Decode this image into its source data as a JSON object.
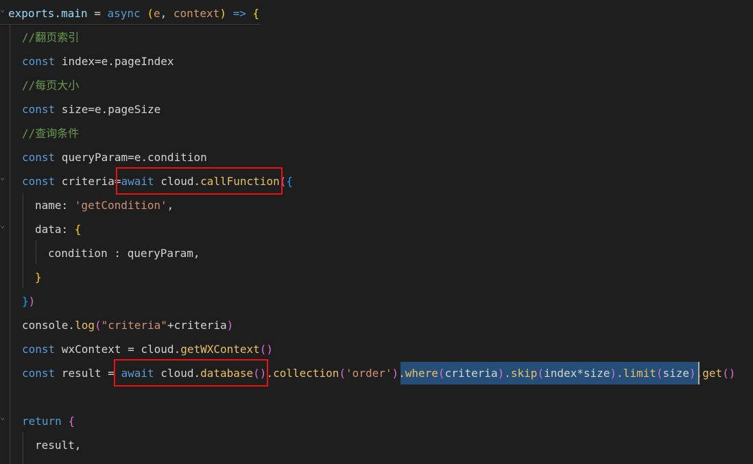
{
  "editor": {
    "lines": [
      {
        "id": "l1",
        "tokens": [
          {
            "t": "exports",
            "c": "tok-prop"
          },
          {
            "t": ".",
            "c": "tok-id"
          },
          {
            "t": "main",
            "c": "tok-prop"
          },
          {
            "t": " = ",
            "c": "tok-id"
          },
          {
            "t": "async",
            "c": "tok-kw"
          },
          {
            "t": " ",
            "c": "tok-id"
          },
          {
            "t": "(",
            "c": "tok-br"
          },
          {
            "t": "e",
            "c": "tok-param"
          },
          {
            "t": ", ",
            "c": "tok-id"
          },
          {
            "t": "context",
            "c": "tok-param"
          },
          {
            "t": ")",
            "c": "tok-br"
          },
          {
            "t": " => ",
            "c": "tok-kw"
          },
          {
            "t": "{",
            "c": "tok-br"
          }
        ]
      },
      {
        "id": "l2",
        "tokens": [
          {
            "t": "//翻页索引",
            "c": "tok-cm"
          }
        ]
      },
      {
        "id": "l3",
        "tokens": [
          {
            "t": "const",
            "c": "tok-kw"
          },
          {
            "t": " index=e.pageIndex",
            "c": "tok-id"
          }
        ]
      },
      {
        "id": "l4",
        "tokens": [
          {
            "t": "//每页大小",
            "c": "tok-cm"
          }
        ]
      },
      {
        "id": "l5",
        "tokens": [
          {
            "t": "const",
            "c": "tok-kw"
          },
          {
            "t": " size=e.pageSize",
            "c": "tok-id"
          }
        ]
      },
      {
        "id": "l6",
        "tokens": [
          {
            "t": "//查询条件",
            "c": "tok-cm"
          }
        ]
      },
      {
        "id": "l7",
        "tokens": [
          {
            "t": "const",
            "c": "tok-kw"
          },
          {
            "t": " queryParam=e.condition",
            "c": "tok-id"
          }
        ]
      },
      {
        "id": "l8",
        "tokens": [
          {
            "t": "const",
            "c": "tok-kw"
          },
          {
            "t": " criteria=",
            "c": "tok-id"
          },
          {
            "t": "await",
            "c": "tok-kw"
          },
          {
            "t": " cloud.",
            "c": "tok-id"
          },
          {
            "t": "callFunction",
            "c": "tok-fn"
          },
          {
            "t": "(",
            "c": "tok-br2"
          },
          {
            "t": "{",
            "c": "tok-br3"
          }
        ]
      },
      {
        "id": "l9",
        "tokens": [
          {
            "t": "name: ",
            "c": "tok-id"
          },
          {
            "t": "'getCondition'",
            "c": "tok-str"
          },
          {
            "t": ",",
            "c": "tok-id"
          }
        ]
      },
      {
        "id": "l10",
        "tokens": [
          {
            "t": "data: ",
            "c": "tok-id"
          },
          {
            "t": "{",
            "c": "tok-br"
          }
        ]
      },
      {
        "id": "l11",
        "tokens": [
          {
            "t": "condition : queryParam,",
            "c": "tok-id"
          }
        ]
      },
      {
        "id": "l12",
        "tokens": [
          {
            "t": "}",
            "c": "tok-br"
          }
        ]
      },
      {
        "id": "l13",
        "tokens": [
          {
            "t": "}",
            "c": "tok-br3"
          },
          {
            "t": ")",
            "c": "tok-br2"
          }
        ]
      },
      {
        "id": "l14",
        "tokens": [
          {
            "t": "console.",
            "c": "tok-id"
          },
          {
            "t": "log",
            "c": "tok-fn"
          },
          {
            "t": "(",
            "c": "tok-br2"
          },
          {
            "t": "\"criteria\"",
            "c": "tok-str"
          },
          {
            "t": "+criteria",
            "c": "tok-id"
          },
          {
            "t": ")",
            "c": "tok-br2"
          }
        ]
      },
      {
        "id": "l15",
        "tokens": [
          {
            "t": "const",
            "c": "tok-kw"
          },
          {
            "t": " wxContext = cloud.",
            "c": "tok-id"
          },
          {
            "t": "getWXContext",
            "c": "tok-fn"
          },
          {
            "t": "()",
            "c": "tok-br2"
          }
        ]
      },
      {
        "id": "l16",
        "tokens": [
          {
            "t": "const",
            "c": "tok-kw"
          },
          {
            "t": " result = ",
            "c": "tok-id"
          },
          {
            "t": "await",
            "c": "tok-kw"
          },
          {
            "t": " cloud.",
            "c": "tok-id"
          },
          {
            "t": "database",
            "c": "tok-fn"
          },
          {
            "t": "()",
            "c": "tok-br2"
          },
          {
            "t": ".collection",
            "c": "tok-fn"
          },
          {
            "t": "(",
            "c": "tok-br2"
          },
          {
            "t": "'order'",
            "c": "tok-str"
          },
          {
            "t": ")",
            "c": "tok-br2"
          },
          {
            "t": ".where",
            "c": "tok-fn"
          },
          {
            "t": "(",
            "c": "tok-br2"
          },
          {
            "t": "criteria",
            "c": "tok-id"
          },
          {
            "t": ")",
            "c": "tok-br2"
          },
          {
            "t": ".skip",
            "c": "tok-fn"
          },
          {
            "t": "(",
            "c": "tok-br2"
          },
          {
            "t": "index*size",
            "c": "tok-id"
          },
          {
            "t": ")",
            "c": "tok-br2"
          },
          {
            "t": ".limit",
            "c": "tok-fn"
          },
          {
            "t": "(",
            "c": "tok-br2"
          },
          {
            "t": "size",
            "c": "tok-id"
          },
          {
            "t": ")",
            "c": "tok-br2"
          },
          {
            "t": ".get",
            "c": "tok-fn"
          },
          {
            "t": "()",
            "c": "tok-br2"
          }
        ]
      },
      {
        "id": "l17",
        "tokens": []
      },
      {
        "id": "l18",
        "tokens": [
          {
            "t": "return",
            "c": "tok-kw"
          },
          {
            "t": " ",
            "c": "tok-id"
          },
          {
            "t": "{",
            "c": "tok-br2"
          }
        ]
      },
      {
        "id": "l19",
        "tokens": [
          {
            "t": "result,",
            "c": "tok-id"
          }
        ]
      }
    ]
  }
}
